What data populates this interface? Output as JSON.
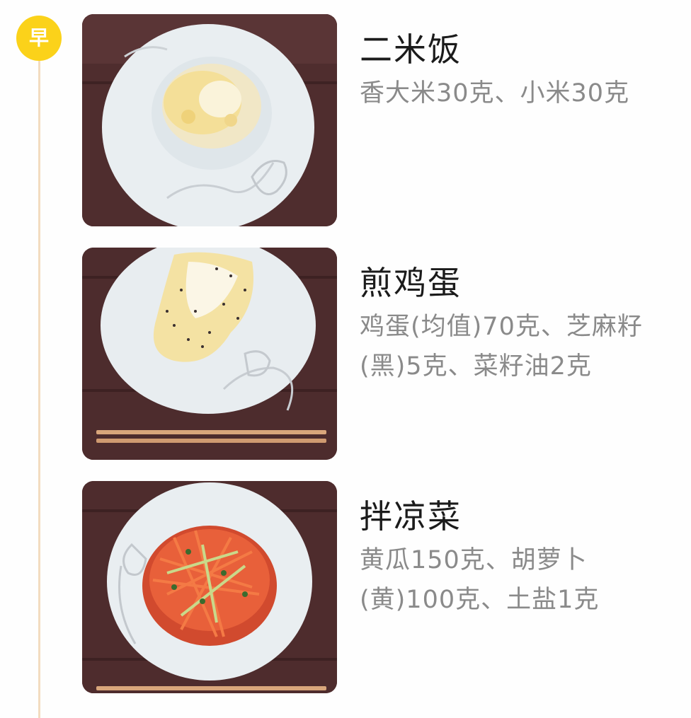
{
  "meal": {
    "badge": "早",
    "badge_color": "#fbd21a",
    "timeline_color": "#f3dcc0"
  },
  "dishes": [
    {
      "name": "二米饭",
      "ingredients": "香大米30克、小米30克",
      "photo_icon": "rice-bowl-photo"
    },
    {
      "name": "煎鸡蛋",
      "ingredients": "鸡蛋(均值)70克、芝麻籽(黑)5克、菜籽油2克",
      "photo_icon": "fried-egg-photo"
    },
    {
      "name": "拌凉菜",
      "ingredients": "黄瓜150克、胡萝卜(黄)100克、土盐1克",
      "photo_icon": "salad-photo"
    }
  ]
}
